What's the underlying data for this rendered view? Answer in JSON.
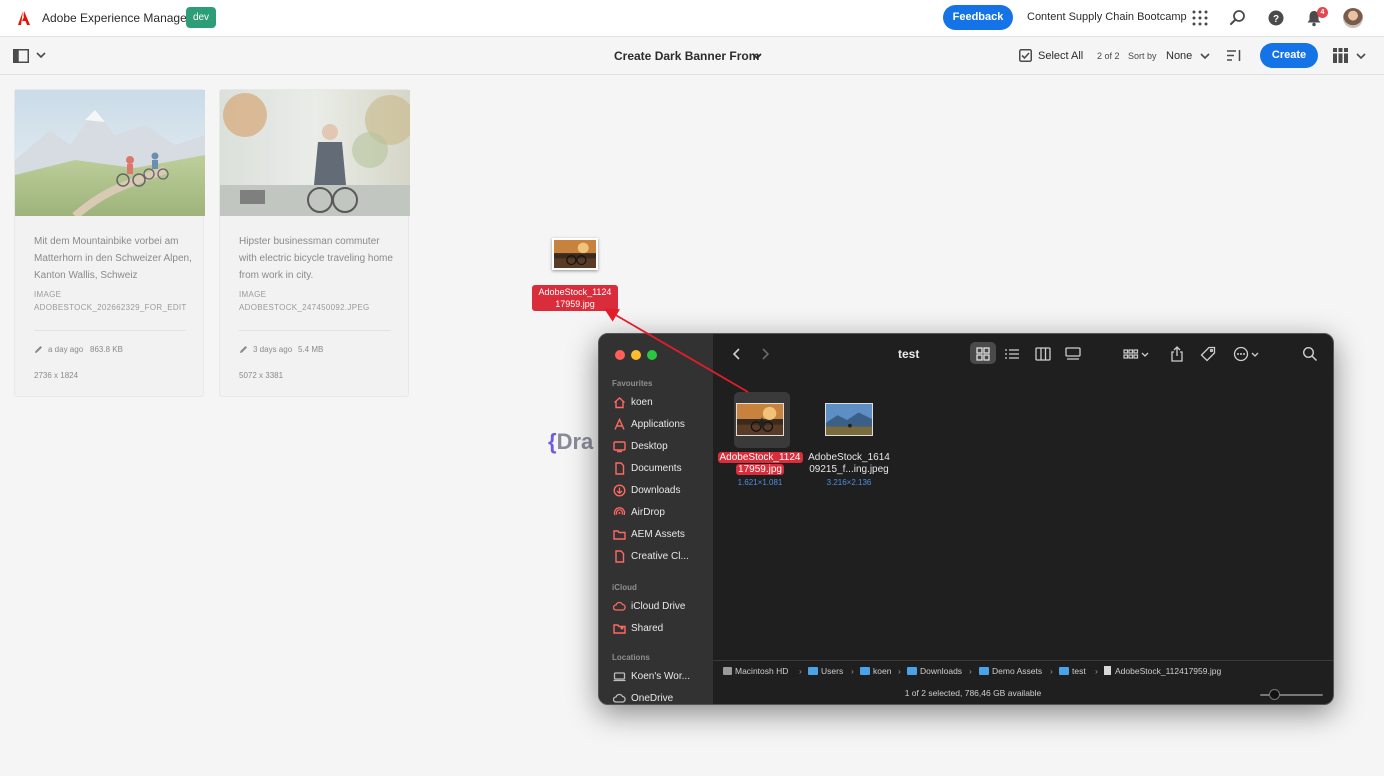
{
  "header": {
    "app_title": "Adobe Experience Manager",
    "env_badge": "dev",
    "feedback_label": "Feedback",
    "org_name": "Content Supply Chain Bootcamp",
    "notification_count": "4",
    "icons": [
      "adobe-logo",
      "apps-grid-icon",
      "search-icon",
      "help-icon",
      "bell-icon",
      "avatar"
    ],
    "brand_colors": {
      "accent_blue": "#1473e6",
      "env_green": "#2d9d78",
      "adobe_red": "#eb1000"
    }
  },
  "actionbar": {
    "view_title": "Create Dark Banner From",
    "select_all_label": "Select All",
    "count_label": "2 of 2",
    "sort_by_label": "Sort by",
    "sort_value": "None",
    "create_label": "Create"
  },
  "cards": [
    {
      "title": "Mit dem Mountainbike vorbei am Matterhorn in den Schweizer Alpen, Kanton Wallis, Schweiz",
      "type": "IMAGE",
      "filename": "ADOBESTOCK_202662329_FOR_EDIT",
      "modified": "a day ago",
      "size": "863.8 KB",
      "dimensions": "2736 x 1824"
    },
    {
      "title": "Hipster businessman commuter with electric bicycle traveling home from work in city.",
      "type": "IMAGE",
      "filename": "ADOBESTOCK_247450092.JPEG",
      "modified": "3 days ago",
      "size": "5.4 MB",
      "dimensions": "5072 x 3381"
    }
  ],
  "drop_hint": {
    "brace": "{",
    "text": "Dra"
  },
  "drag_ghost": {
    "filename_line1": "AdobeStock_1124",
    "filename_line2": "17959.jpg"
  },
  "finder": {
    "title": "test",
    "sidebar_sections": [
      {
        "title": "Favourites",
        "items": [
          {
            "label": "koen",
            "icon": "home-icon"
          },
          {
            "label": "Applications",
            "icon": "applications-icon"
          },
          {
            "label": "Desktop",
            "icon": "desktop-icon"
          },
          {
            "label": "Documents",
            "icon": "document-icon"
          },
          {
            "label": "Downloads",
            "icon": "downloads-icon"
          },
          {
            "label": "AirDrop",
            "icon": "airdrop-icon"
          },
          {
            "label": "AEM Assets",
            "icon": "folder-icon"
          },
          {
            "label": "Creative Cl...",
            "icon": "document-icon"
          }
        ]
      },
      {
        "title": "iCloud",
        "items": [
          {
            "label": "iCloud Drive",
            "icon": "cloud-icon"
          },
          {
            "label": "Shared",
            "icon": "shared-folder-icon"
          }
        ]
      },
      {
        "title": "Locations",
        "items": [
          {
            "label": "Koen's Wor...",
            "icon": "computer-icon"
          },
          {
            "label": "OneDrive",
            "icon": "cloud-icon"
          }
        ]
      }
    ],
    "files": [
      {
        "name_line1": "AdobeStock_1124",
        "name_line2": "17959.jpg",
        "dims": "1.621×1.081",
        "selected": true
      },
      {
        "name_line1": "AdobeStock_1614",
        "name_line2": "09215_f...ing.jpeg",
        "dims": "3.216×2.136",
        "selected": false
      }
    ],
    "path": [
      "Macintosh HD",
      "Users",
      "koen",
      "Downloads",
      "Demo Assets",
      "test",
      "AdobeStock_112417959.jpg"
    ],
    "status": "1 of 2 selected, 786,46 GB available"
  }
}
